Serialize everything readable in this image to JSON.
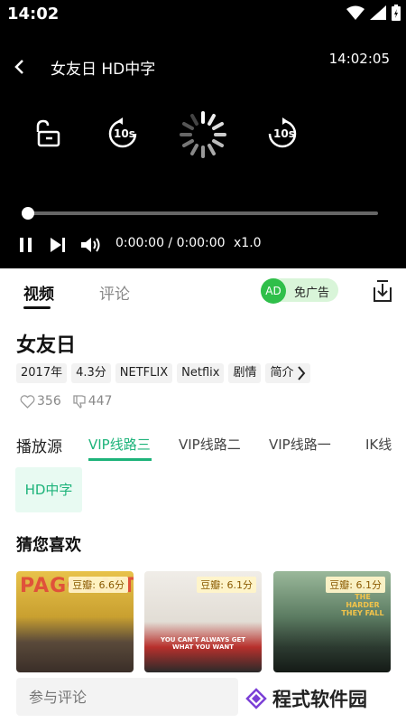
{
  "status_bar": {
    "time": "14:02"
  },
  "player": {
    "title": "女友日 HD中字",
    "clock": "14:02:05",
    "timecode": "0:00:00 / 0:00:00",
    "speed": "x1.0",
    "progress": 0,
    "rewind_label": "10s",
    "forward_label": "10s"
  },
  "tabs": [
    {
      "label": "视频"
    },
    {
      "label": "评论"
    }
  ],
  "ad_badge": {
    "icon_text": "AD",
    "label": "免广告"
  },
  "movie": {
    "title": "女友日",
    "chips": [
      "2017年",
      "4.3分",
      "NETFLIX",
      "Netflix",
      "剧情",
      "简介"
    ],
    "likes": "356",
    "dislikes": "447"
  },
  "source": {
    "label": "播放源",
    "lines": [
      "VIP线路三",
      "VIP线路二",
      "VIP线路一",
      "IK线"
    ],
    "quality": "HD中字"
  },
  "recommend": {
    "heading": "猜您喜欢",
    "items": [
      {
        "poster_text": "PAGGLAIT",
        "rating": "豆瓣: 6.6分"
      },
      {
        "poster_text": "YOU CAN'T ALWAYS GET WHAT YOU WANT",
        "rating": "豆瓣: 6.1分"
      },
      {
        "poster_text": "THE HARDER THEY FALL",
        "rating": "豆瓣: 6.1分"
      }
    ]
  },
  "comment": {
    "placeholder": "参与评论"
  },
  "brand": {
    "name": "程式软件园"
  },
  "colors": {
    "accent": "#1db37a",
    "ad_green": "#2fbf4a"
  }
}
